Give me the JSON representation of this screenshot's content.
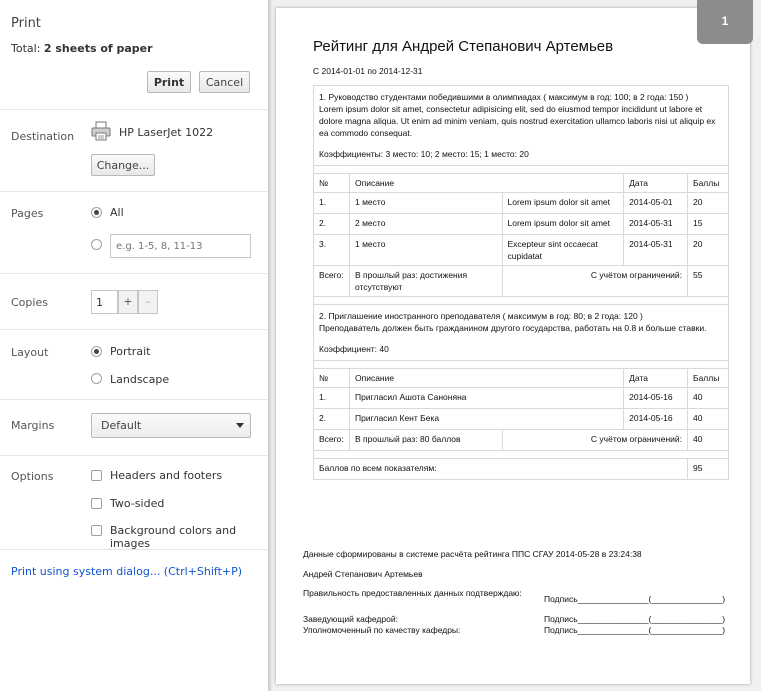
{
  "panel": {
    "title": "Print",
    "total_label": "Total:",
    "total_value": "2 sheets of paper",
    "print_button": "Print",
    "cancel_button": "Cancel",
    "destination_label": "Destination",
    "destination_printer": "HP LaserJet 1022",
    "change_button": "Change...",
    "pages_label": "Pages",
    "pages_all": "All",
    "pages_placeholder": "e.g. 1-5, 8, 11-13",
    "copies_label": "Copies",
    "copies_value": "1",
    "copies_plus": "+",
    "copies_minus": "–",
    "layout_label": "Layout",
    "layout_portrait": "Portrait",
    "layout_landscape": "Landscape",
    "margins_label": "Margins",
    "margins_value": "Default",
    "options_label": "Options",
    "opt_headers": "Headers and footers",
    "opt_two_sided": "Two-sided",
    "opt_background": "Background colors and images",
    "system_dialog_link": "Print using system dialog... (Ctrl+Shift+P)"
  },
  "preview": {
    "page_number": "1",
    "title": "Рейтинг для Андрей Степанович Артемьев",
    "period": "С 2014-01-01 по 2014-12-31",
    "section1": {
      "heading": "1. Руководство студентами победившими в олимпиадах ( максимум в год: 100; в 2 года: 150 )",
      "description": "Lorem ipsum dolor sit amet, consectetur adipisicing elit, sed do eiusmod tempor incididunt ut labore et dolore magna aliqua. Ut enim ad minim veniam, quis nostrud exercitation ullamco laboris nisi ut aliquip ex ea commodo consequat.",
      "coefficients": "Коэффициенты: 3 место: 10; 2 место: 15; 1 место: 20",
      "headers": [
        "№",
        "Описание",
        "",
        "Дата",
        "Баллы"
      ],
      "rows": [
        [
          "1.",
          "1 место",
          "Lorem ipsum dolor sit amet",
          "2014-05-01",
          "20"
        ],
        [
          "2.",
          "2 место",
          "Lorem ipsum dolor sit amet",
          "2014-05-31",
          "15"
        ],
        [
          "3.",
          "1 место",
          "Excepteur sint occaecat cupidatat",
          "2014-05-31",
          "20"
        ]
      ],
      "total_label": "Всего:",
      "total_prev": "В прошлый раз: достижения отсутствуют",
      "total_limit_label": "С учётом ограничений:",
      "total_value": "55"
    },
    "section2": {
      "heading": "2. Приглашение иностранного преподавателя ( максимум в год: 80; в 2 года: 120 )",
      "description": "Преподаватель должен быть гражданином другого государства, работать на 0.8 и больше ставки.",
      "coefficients": "Коэффициент: 40",
      "headers": [
        "№",
        "Описание",
        "",
        "Дата",
        "Баллы"
      ],
      "rows": [
        [
          "1.",
          "Пригласил Ашота Саноняна",
          "",
          "2014-05-16",
          "40"
        ],
        [
          "2.",
          "Пригласил Кент Бека",
          "",
          "2014-05-16",
          "40"
        ]
      ],
      "total_label": "Всего:",
      "total_prev": "В прошлый раз: 80 баллов",
      "total_limit_label": "С учётом ограничений:",
      "total_value": "40"
    },
    "grand_total_label": "Баллов по всем показателям:",
    "grand_total_value": "95",
    "footer_generated": "Данные сформированы в системе расчёта рейтинга ППС СГАУ 2014-05-28 в 23:24:38",
    "footer_name": "Андрей Степанович Артемьев",
    "footer_confirm": "Правильность предоставленных данных подтверждаю:",
    "footer_head": "Заведующий кафедрой:",
    "footer_quality": "Уполномоченный по качеству кафедры:",
    "signature": "Подпись_______________(_______________)"
  }
}
